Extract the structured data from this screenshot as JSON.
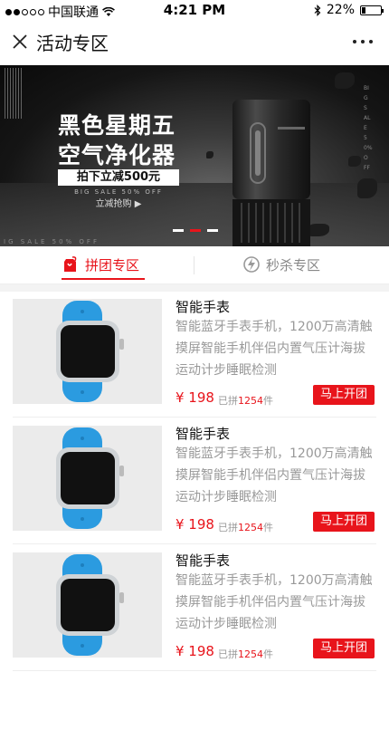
{
  "status_bar": {
    "carrier": "中国联通",
    "time": "4:21 PM",
    "battery": "22%",
    "battery_level": 0.22
  },
  "nav": {
    "title": "活动专区"
  },
  "banner": {
    "headline_1": "黑色星期五",
    "headline_2": "空气净化器",
    "promo": "拍下立减500元",
    "english": "BIG SALE 50% OFF",
    "cta": "立减抢购 ▶",
    "english_bottom": "IG SALE 50% OFF",
    "slides": 3,
    "active_slide": 2
  },
  "tabs": [
    {
      "label": "拼团专区",
      "active": true
    },
    {
      "label": "秒杀专区",
      "active": false
    }
  ],
  "products": [
    {
      "name": "智能手表",
      "desc": "智能蓝牙手表手机，1200万高清触摸屏智能手机伴侣内置气压计海拔运动计步睡眠检测",
      "price": "¥ 198",
      "sold_prefix": "已拼",
      "sold_count": "1254",
      "sold_suffix": "件",
      "button": "马上开团"
    },
    {
      "name": "智能手表",
      "desc": "智能蓝牙手表手机，1200万高清触摸屏智能手机伴侣内置气压计海拔运动计步睡眠检测",
      "price": "¥ 198",
      "sold_prefix": "已拼",
      "sold_count": "1254",
      "sold_suffix": "件",
      "button": "马上开团"
    },
    {
      "name": "智能手表",
      "desc": "智能蓝牙手表手机，1200万高清触摸屏智能手机伴侣内置气压计海拔运动计步睡眠检测",
      "price": "¥ 198",
      "sold_prefix": "已拼",
      "sold_count": "1254",
      "sold_suffix": "件",
      "button": "马上开团"
    }
  ],
  "colors": {
    "accent": "#e8141b",
    "watch_band": "#2b9be0"
  }
}
